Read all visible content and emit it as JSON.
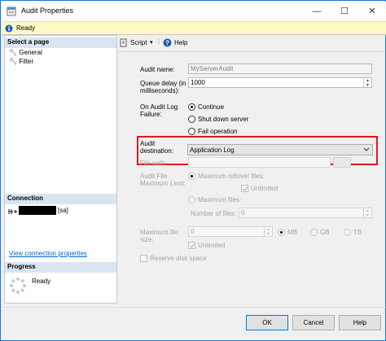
{
  "window": {
    "title": "Audit Properties",
    "minimize": "—",
    "maximize": "☐",
    "close": "✕"
  },
  "status_bar": {
    "text": "Ready"
  },
  "left": {
    "select_page_header": "Select a page",
    "pages": [
      "General",
      "Filter"
    ],
    "connection_header": "Connection",
    "connection_user": "[sa]",
    "view_connection_link": "View connection properties",
    "progress_header": "Progress",
    "progress_text": "Ready"
  },
  "toolbar": {
    "script_label": "Script",
    "script_arrow": "▾",
    "help_label": "Help"
  },
  "form": {
    "audit_name_label": "Audit name:",
    "audit_name_value": "MyServerAudit",
    "queue_delay_label_1": "Queue delay (in",
    "queue_delay_label_2": "milliseconds):",
    "queue_delay_value": "1000",
    "on_failure_label_1": "On Audit Log",
    "on_failure_label_2": "Failure:",
    "on_failure_options": [
      "Continue",
      "Shut down server",
      "Fail operation"
    ],
    "on_failure_selected": "Continue",
    "destination_label_1": "Audit",
    "destination_label_2": "destination:",
    "destination_value": "Application Log",
    "file_path_label": "File path:",
    "max_limit_label_1": "Audit File",
    "max_limit_label_2": "Maximum Limit:",
    "max_rollover_label": "Maximum rollover files:",
    "unlimited_label": "Unlimited",
    "max_files_label": "Maximum files:",
    "number_of_files_label": "Number of files:",
    "number_of_files_value": "0",
    "max_file_size_label_1": "Maximum file",
    "max_file_size_label_2": "size:",
    "max_file_size_value": "0",
    "size_units": [
      "MB",
      "GB",
      "TB"
    ],
    "unlimited_size_label": "Unlimited",
    "reserve_disk_label": "Reserve disk space"
  },
  "buttons": {
    "ok": "OK",
    "cancel": "Cancel",
    "help": "Help"
  },
  "colors": {
    "highlight_border": "#e0151e",
    "section_header": "#dbe5f1",
    "status_bar": "#fff8c4",
    "link": "#0066cc"
  }
}
